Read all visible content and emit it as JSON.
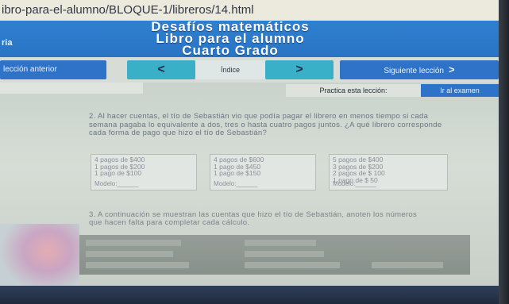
{
  "browser": {
    "url": "ibro-para-el-alumno/BLOQUE-1/libreros/14.html"
  },
  "header": {
    "side_label": "ria",
    "title_line1": "Desafíos matemáticos",
    "title_line2": "Libro para el alumno",
    "title_line3": "Cuarto Grado"
  },
  "nav": {
    "prev_label": "lección anterior",
    "left_arrow": "<",
    "index_label": "Índice",
    "right_arrow": ">",
    "next_label": "Siguiente lección",
    "next_arrow": ">"
  },
  "practice": {
    "label": "Practica esta lección:",
    "exam_button": "Ir al examen"
  },
  "question2": {
    "text": "2. Al hacer cuentas, el tío de Sebastián vio que podía pagar el librero en menos tiempo si cada semana pagaba lo equivalente a dos, tres o hasta cuatro pagos juntos. ¿A qué librero corresponde cada forma de pago que hizo el tío de Sebastián?"
  },
  "cards": [
    {
      "lines": [
        "4 pagos de $400",
        "1 pagos de $200",
        "1 pago  de  $100"
      ],
      "model": "Modelo:______"
    },
    {
      "lines": [
        "4 pagos de $600",
        "1 pago  de  $450",
        "1 pago  de  $150"
      ],
      "model": "Modelo:______"
    },
    {
      "lines": [
        "5 pagos de $400",
        "3 pagos de $200",
        "2 pagos de $ 100",
        "1 pago  de  $ 50"
      ],
      "model": "Modelo:______"
    }
  ],
  "question3": {
    "text": "3. A continuación se muestran las cuentas que hizo el tío de Sebastián, anoten los números que hacen falta para completar cada cálculo."
  }
}
